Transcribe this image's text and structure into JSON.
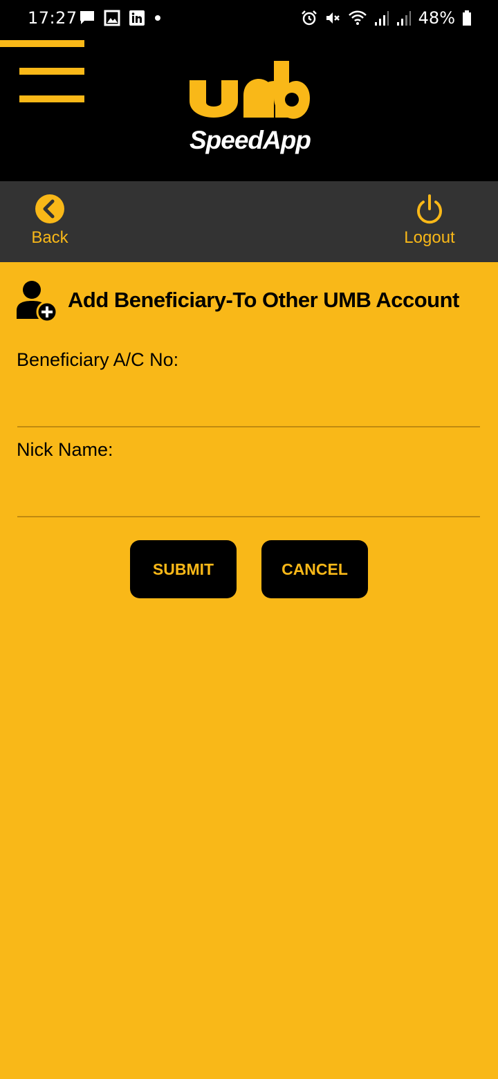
{
  "status_bar": {
    "time": "17:27",
    "battery": "48%",
    "left_icons": [
      "message-icon",
      "image-icon",
      "linkedin-icon",
      "dot-icon"
    ],
    "right_icons": [
      "alarm-icon",
      "mute-icon",
      "wifi-icon",
      "signal-icon",
      "signal-icon",
      "battery-icon"
    ]
  },
  "header": {
    "logo_text": "umb",
    "logo_subtitle": "SpeedApp",
    "menu_icon": "hamburger-icon"
  },
  "nav": {
    "back_label": "Back",
    "logout_label": "Logout"
  },
  "form": {
    "title": "Add Beneficiary-To Other UMB Account",
    "account_label": "Beneficiary A/C No:",
    "account_value": "",
    "nickname_label": "Nick Name:",
    "nickname_value": "",
    "submit_label": "SUBMIT",
    "cancel_label": "CANCEL"
  },
  "colors": {
    "accent": "#f9b818",
    "header_bg": "#000000",
    "nav_bg": "#333333"
  }
}
